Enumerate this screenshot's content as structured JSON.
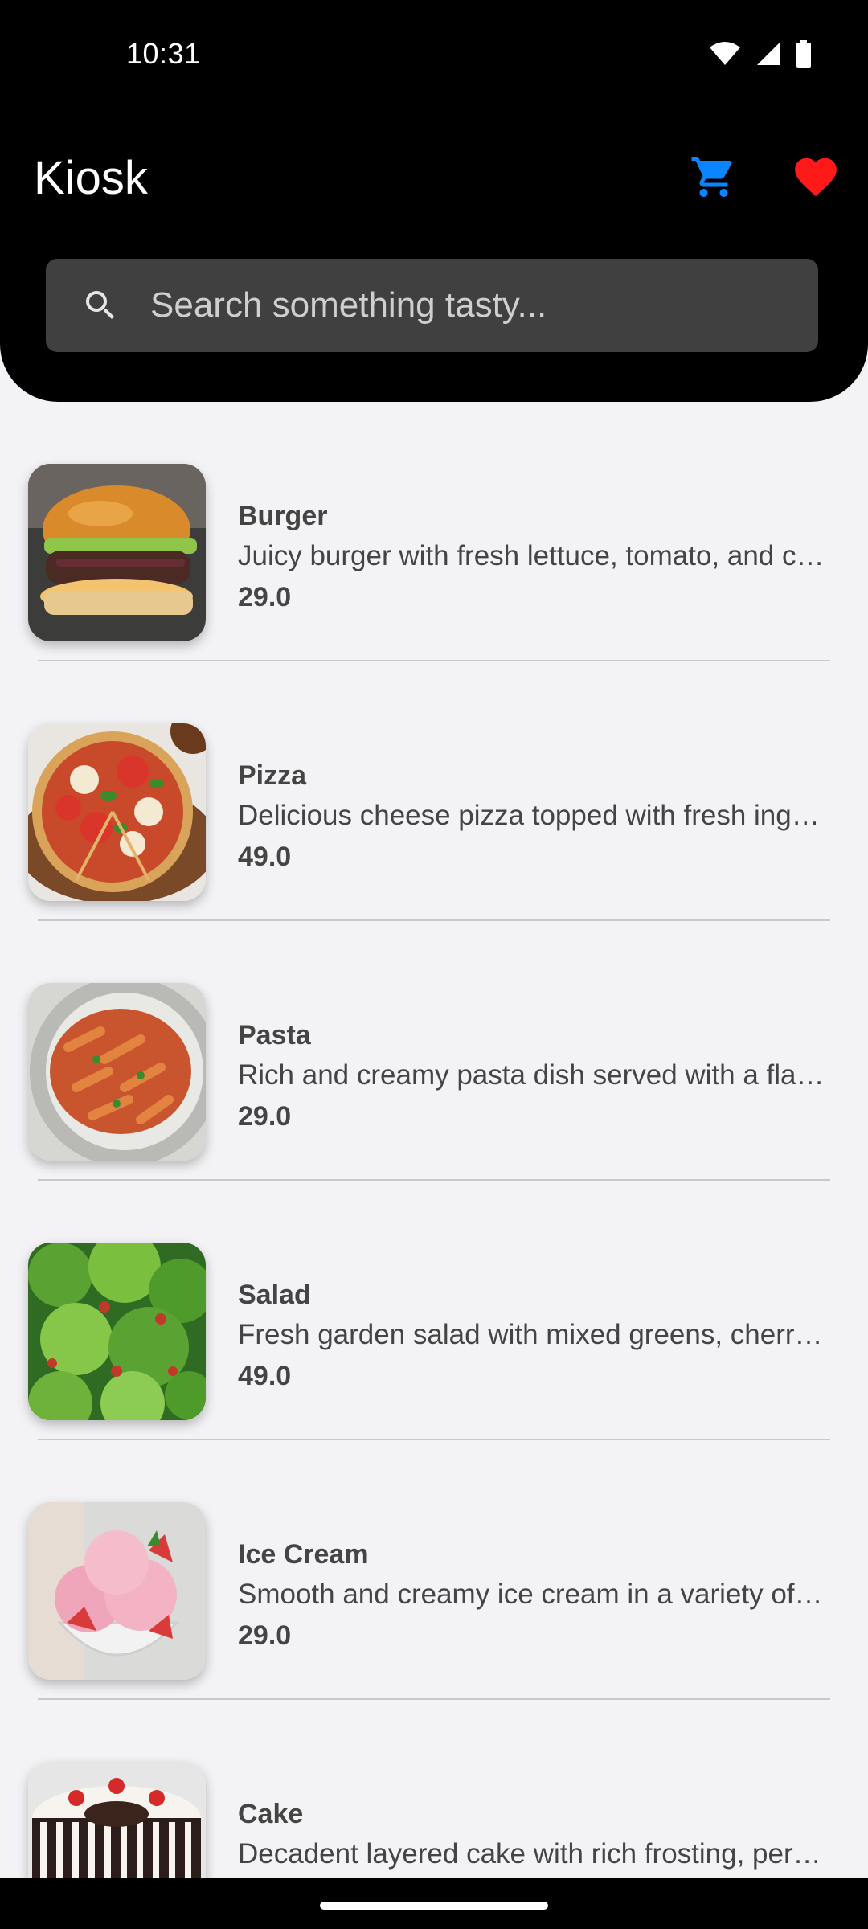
{
  "status": {
    "time": "10:31"
  },
  "app": {
    "title": "Kiosk"
  },
  "colors": {
    "cart_icon": "#0a84ff",
    "favorite_icon": "#ff1a1a",
    "header_bg": "#000000",
    "page_bg": "#f3f3f6"
  },
  "search": {
    "placeholder": "Search something tasty...",
    "value": ""
  },
  "items": [
    {
      "name": "Burger",
      "description": "Juicy burger with fresh lettuce, tomato, and c…",
      "price": "29.0",
      "image": "burger"
    },
    {
      "name": "Pizza",
      "description": "Delicious cheese pizza topped with fresh ing…",
      "price": "49.0",
      "image": "pizza"
    },
    {
      "name": "Pasta",
      "description": "Rich and creamy pasta dish served with a fla…",
      "price": "29.0",
      "image": "pasta"
    },
    {
      "name": "Salad",
      "description": "Fresh garden salad with mixed greens, cherr…",
      "price": "49.0",
      "image": "salad"
    },
    {
      "name": "Ice Cream",
      "description": "Smooth and creamy ice cream in a variety of…",
      "price": "29.0",
      "image": "ice-cream"
    },
    {
      "name": "Cake",
      "description": "Decadent layered cake with rich frosting, per…",
      "price": "",
      "image": "cake"
    }
  ]
}
